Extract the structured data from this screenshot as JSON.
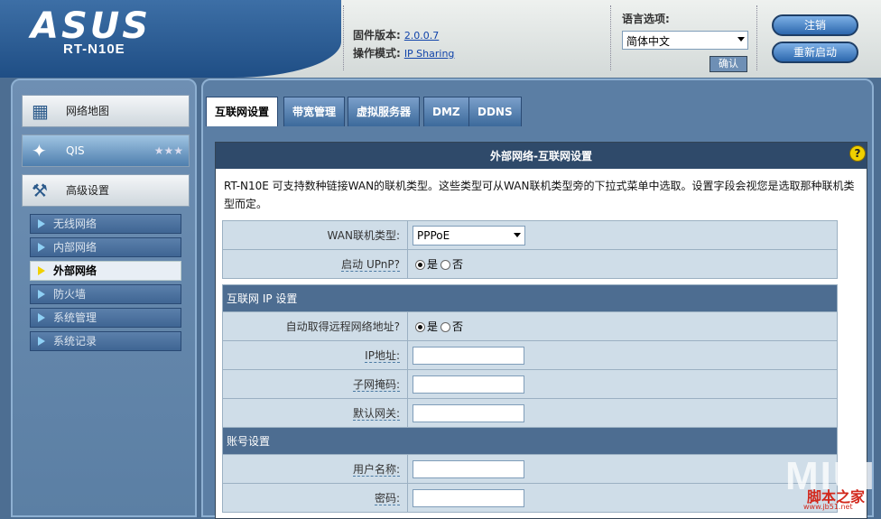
{
  "header": {
    "logo": "ASUS",
    "model": "RT-N10E",
    "firmware_label": "固件版本:",
    "firmware_value": "2.0.0.7",
    "mode_label": "操作模式:",
    "mode_value": "IP Sharing",
    "language_label": "语言选项:",
    "language_value": "简体中文",
    "apply_label": "确认",
    "logout_label": "注销",
    "reboot_label": "重新启动"
  },
  "sidebar": {
    "main": [
      {
        "label": "网络地图",
        "icon": "network-map-icon"
      },
      {
        "label": "QIS",
        "icon": "magic-wand-icon"
      },
      {
        "label": "高级设置",
        "icon": "tools-icon"
      }
    ],
    "sub": [
      {
        "label": "无线网络"
      },
      {
        "label": "内部网络"
      },
      {
        "label": "外部网络",
        "active": true
      },
      {
        "label": "防火墙"
      },
      {
        "label": "系统管理"
      },
      {
        "label": "系统记录"
      }
    ]
  },
  "tabs": [
    {
      "label": "互联网设置",
      "active": true
    },
    {
      "label": "带宽管理"
    },
    {
      "label": "虚拟服务器"
    },
    {
      "label": "DMZ"
    },
    {
      "label": "DDNS"
    }
  ],
  "panel": {
    "title": "外部网络-互联网设置",
    "description": "RT-N10E 可支持数种链接WAN的联机类型。这些类型可从WAN联机类型旁的下拉式菜单中选取。设置字段会视您是选取那种联机类型而定。",
    "wan_type_label": "WAN联机类型:",
    "wan_type_value": "PPPoE",
    "upnp_label": "启动 UPnP?",
    "yes": "是",
    "no": "否",
    "ip_section": "互联网 IP 设置",
    "auto_ip_label": "自动取得远程网络地址?",
    "ip_label": "IP地址:",
    "subnet_label": "子网掩码:",
    "gateway_label": "默认网关:",
    "account_section": "账号设置",
    "username_label": "用户名称:",
    "password_label": "密码:"
  },
  "watermark": {
    "line1": "MIUI",
    "line2": "脚本之家",
    "line3": "www.jb51.net"
  },
  "colors": {
    "header_blue": "#1f4e85",
    "panel_head": "#2f4a6a",
    "row_bg": "#cfdde8",
    "content_bg": "#5b7ea4"
  }
}
